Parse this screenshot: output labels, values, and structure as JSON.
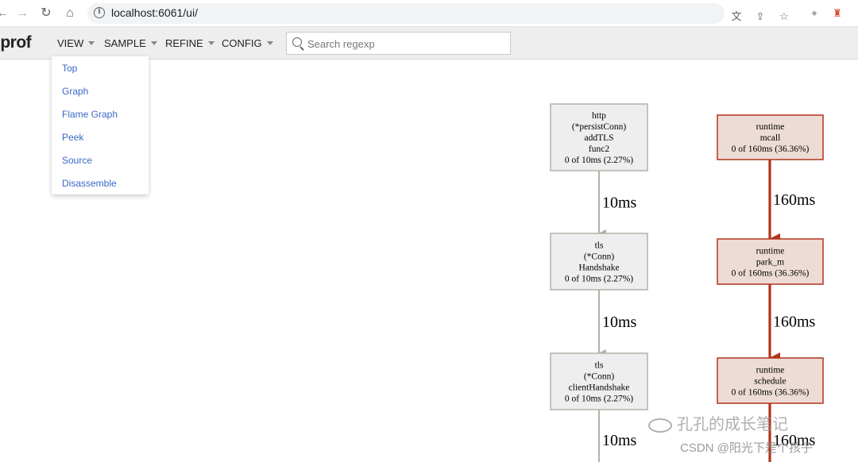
{
  "browser": {
    "url": "localhost:6061/ui/",
    "icons": [
      "back-icon",
      "forward-icon",
      "reload-icon",
      "home-icon",
      "info-icon",
      "translate-icon",
      "share-icon",
      "star-icon",
      "extension-icon",
      "profile-icon"
    ]
  },
  "toolbar": {
    "logo": "pprof",
    "menus": [
      "VIEW",
      "SAMPLE",
      "REFINE",
      "CONFIG"
    ],
    "search_placeholder": "Search regexp"
  },
  "view_menu": {
    "items": [
      "Top",
      "Graph",
      "Flame Graph",
      "Peek",
      "Source",
      "Disassemble"
    ]
  },
  "graph": {
    "left": {
      "nodes": [
        {
          "lines": [
            "http",
            "(*persistConn)",
            "addTLS",
            "func2",
            "0 of 10ms (2.27%)"
          ]
        },
        {
          "lines": [
            "tls",
            "(*Conn)",
            "Handshake",
            "0 of 10ms (2.27%)"
          ]
        },
        {
          "lines": [
            "tls",
            "(*Conn)",
            "clientHandshake",
            "0 of 10ms (2.27%)"
          ]
        }
      ],
      "edges": [
        "10ms",
        "10ms",
        "10ms"
      ]
    },
    "right": {
      "nodes": [
        {
          "lines": [
            "runtime",
            "mcall",
            "0 of 160ms (36.36%)"
          ]
        },
        {
          "lines": [
            "runtime",
            "park_m",
            "0 of 160ms (36.36%)"
          ]
        },
        {
          "lines": [
            "runtime",
            "schedule",
            "0 of 160ms (36.36%)"
          ]
        }
      ],
      "edges": [
        "160ms",
        "160ms",
        "160ms"
      ]
    },
    "colors": {
      "cold_fill": "#eeeeee",
      "cold_stroke": "#b2b2a9",
      "hot_fill": "#eddcd5",
      "hot_stroke": "#b2341d"
    }
  },
  "watermark": {
    "line1": "孔孔的成长笔记",
    "line2": "CSDN @阳光下是个孩子"
  }
}
